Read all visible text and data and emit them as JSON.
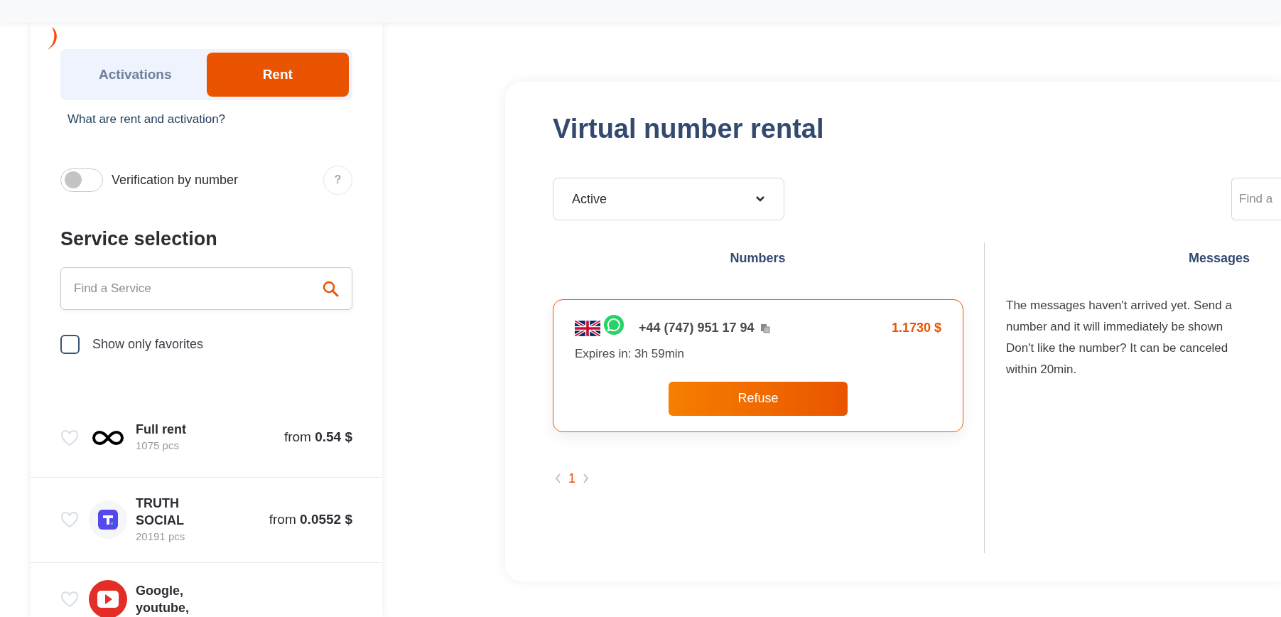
{
  "sidebar": {
    "tabs": [
      {
        "label": "Activations",
        "selected": false
      },
      {
        "label": "Rent",
        "selected": true
      }
    ],
    "help_link": "What are rent and activation?",
    "verification_toggle": {
      "label": "Verification by number",
      "on": false,
      "help": "?"
    },
    "service_selection": {
      "title": "Service selection",
      "search": {
        "placeholder": "Find a Service"
      },
      "favorites_only": {
        "label": "Show only favorites",
        "checked": false
      },
      "services": [
        {
          "name": "Full rent",
          "count": "1075 pcs",
          "price_prefix": "from",
          "price": "0.54 $",
          "kind": "infinity",
          "favorite": false
        },
        {
          "name": "TRUTH SOCIAL",
          "count": "20191 pcs",
          "price_prefix": "from",
          "price": "0.0552 $",
          "kind": "truth",
          "favorite": false
        },
        {
          "name": "Google, youtube,",
          "kind": "youtube",
          "favorite": false
        }
      ]
    }
  },
  "main": {
    "title": "Virtual number rental",
    "status_filter": {
      "value": "Active"
    },
    "search": {
      "placeholder": "Find a"
    },
    "columns": [
      "Numbers",
      "Messages"
    ],
    "numbers": [
      {
        "phone": "+44 (747) 951 17 94",
        "price": "1.1730 $",
        "expires": "Expires in: 3h 59min",
        "action": "Refuse"
      }
    ],
    "pagination": {
      "pages": [
        {
          "label": "1",
          "selected": true
        }
      ]
    },
    "messages_text": [
      "The messages haven't arrived yet. Send a",
      "number and it will immediately be shown",
      "Don't like the number? It can be canceled",
      "within 20min."
    ]
  }
}
